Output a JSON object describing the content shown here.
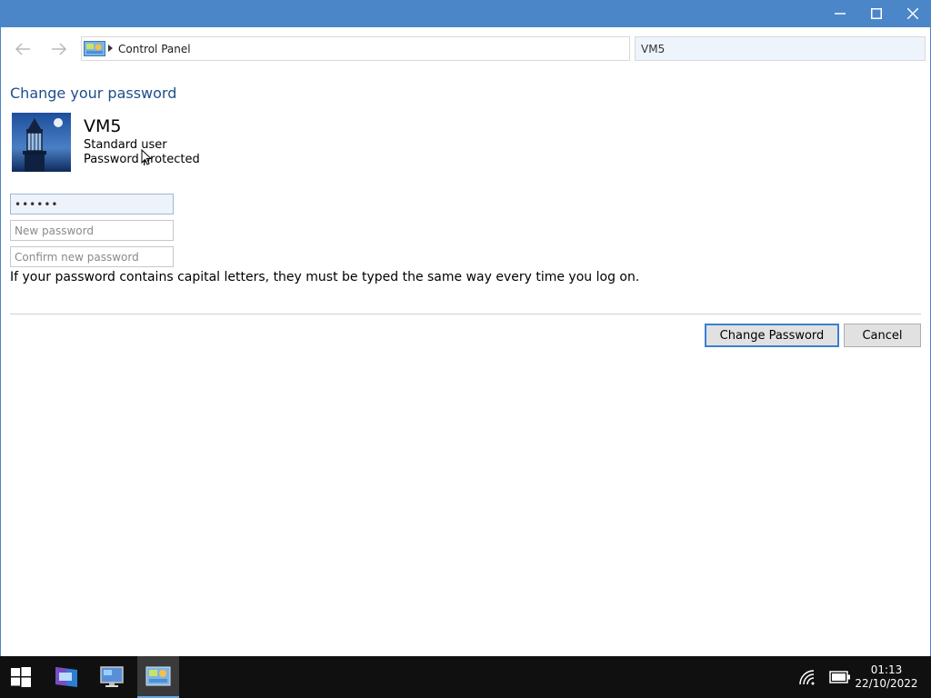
{
  "window": {
    "title": ""
  },
  "nav": {
    "address_path": "Control Panel",
    "search_value": "VM5"
  },
  "page": {
    "title": "Change your password"
  },
  "user": {
    "name": "VM5",
    "type": "Standard user",
    "protection": "Password protected"
  },
  "form": {
    "current_password_value": "••••••",
    "new_password_placeholder": "New password",
    "confirm_password_placeholder": "Confirm new password",
    "hint": "If your password contains capital letters, they must be typed the same way every time you log on."
  },
  "buttons": {
    "change_password": "Change Password",
    "cancel": "Cancel"
  },
  "taskbar": {
    "time": "01:13",
    "date": "22/10/2022"
  },
  "colors": {
    "titlebar": "#4a86c8",
    "title_text": "#1e4e8c",
    "taskbar": "#101010"
  },
  "icons": [
    "minimize-icon",
    "maximize-icon",
    "close-icon",
    "back-arrow-icon",
    "forward-arrow-icon",
    "control-panel-icon",
    "lighthouse-avatar",
    "windows-start-icon",
    "network-icon",
    "battery-icon"
  ]
}
